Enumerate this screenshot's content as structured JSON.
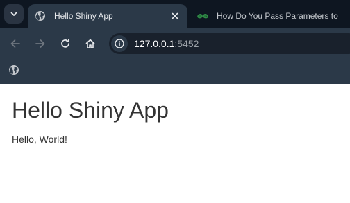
{
  "browser": {
    "tabs": [
      {
        "title": "Hello Shiny App",
        "active": true,
        "favicon": "globe-icon"
      },
      {
        "title": "How Do You Pass Parameters to",
        "active": false,
        "favicon": "geeksforgeeks-icon"
      }
    ],
    "address_bar": {
      "host": "127.0.0.1",
      "port": ":5452"
    }
  },
  "page": {
    "heading": "Hello Shiny App",
    "text": "Hello, World!"
  },
  "colors": {
    "tabstrip": "#0e1621",
    "toolbar": "#2b3948",
    "omnibox": "#19212c",
    "gfg_green": "#2f8d46"
  }
}
